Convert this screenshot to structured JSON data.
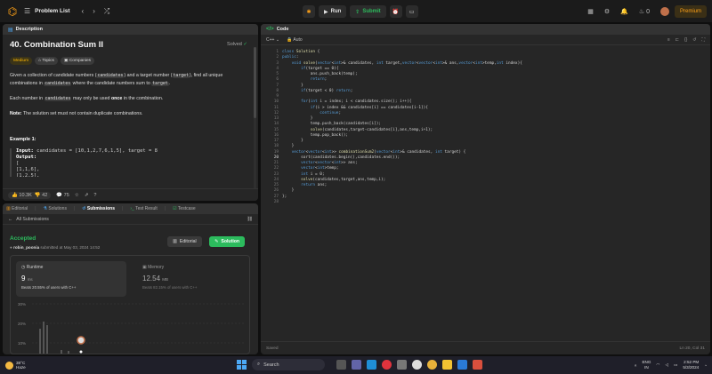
{
  "topbar": {
    "title": "Problem List",
    "run_label": "Run",
    "submit_label": "Submit",
    "streak": "0",
    "premium_label": "Premium"
  },
  "description": {
    "header": "Description",
    "title": "40. Combination Sum II",
    "status": "Solved",
    "tags": [
      "Medium",
      "Topics",
      "Companies"
    ],
    "p1_a": "Given a collection of candidate numbers (",
    "p1_code1": "candidates",
    "p1_b": ") and a target number (",
    "p1_code2": "target",
    "p1_c": "), find all unique combinations in ",
    "p1_code3": "candidates",
    "p1_d": " where the candidate numbers sum to ",
    "p1_code4": "target",
    "p1_e": ".",
    "p2_a": "Each number in ",
    "p2_code": "candidates",
    "p2_b": " may only be used ",
    "p2_bold": "once",
    "p2_c": " in the combination.",
    "note_bold": "Note:",
    "note_text": " The solution set must not contain duplicate combinations.",
    "example_title": "Example 1:",
    "ex_input_label": "Input:",
    "ex_input_value": " candidates = [10,1,2,7,6,1,5], target = 8",
    "ex_output_label": "Output:",
    "ex_line1": "[",
    "ex_line2": "[1,1,6],",
    "ex_line3": "[1,2,5],",
    "likes": "10.3K",
    "dislikes": "42",
    "comments": "75"
  },
  "submissions": {
    "tabs": [
      "Editorial",
      "Solutions",
      "Submissions",
      "Test Result",
      "Testcase"
    ],
    "back_label": "All Submissions",
    "accepted": "Accepted",
    "submitter_name": "robin_poonia",
    "submitted_text": " submitted at May 03, 2024 14:52",
    "editorial_btn": "Editorial",
    "solution_btn": "Solution",
    "runtime_label": "Runtime",
    "runtime_value": "9",
    "runtime_unit": "ms",
    "runtime_beats": "Beats 20.55% of users with C++",
    "memory_label": "Memory",
    "memory_value": "12.54",
    "memory_unit": "MB",
    "memory_beats": "Beats 82.15% of users with C++",
    "chart_ticks": [
      "30%",
      "20%",
      "10%"
    ]
  },
  "code": {
    "header": "Code",
    "language": "C++",
    "mode": "Auto",
    "saved": "Saved",
    "cursor": "Ln 20, Col 31",
    "lines": [
      "class Solution {",
      "public:",
      "    void solve(vector<int>& candidates, int target,vector<vector<int>& ans,vector<int>temp,int index){",
      "        if(target == 0){",
      "            ans.push_back(temp);",
      "            return;",
      "        }",
      "        if(target < 0) return;",
      "",
      "        for(int i = index; i < candidates.size(); i++){",
      "            if(i > index && candidates[i] == candidates[i-1]){",
      "                continue;",
      "            }",
      "            temp.push_back(candidates[i]);",
      "            solve(candidates,target-candidates[i],ans,temp,i+1);",
      "            temp.pop_back();",
      "        }",
      "    }",
      "    vector<vector<int>> combinationSum2(vector<int>& candidates, int target) {",
      "        sort(candidates.begin(),candidates.end());",
      "        vector<vector<int>> ans;",
      "        vector<int>temp;",
      "        int i = 0;",
      "        solve(candidates,target,ans,temp,i);",
      "        return ans;",
      "    }",
      "};",
      ""
    ]
  },
  "taskbar": {
    "temp": "38°C",
    "weather": "Haze",
    "search": "Search",
    "lang1": "ENG",
    "lang2": "IN",
    "time": "2:52 PM",
    "date": "5/3/2024"
  }
}
